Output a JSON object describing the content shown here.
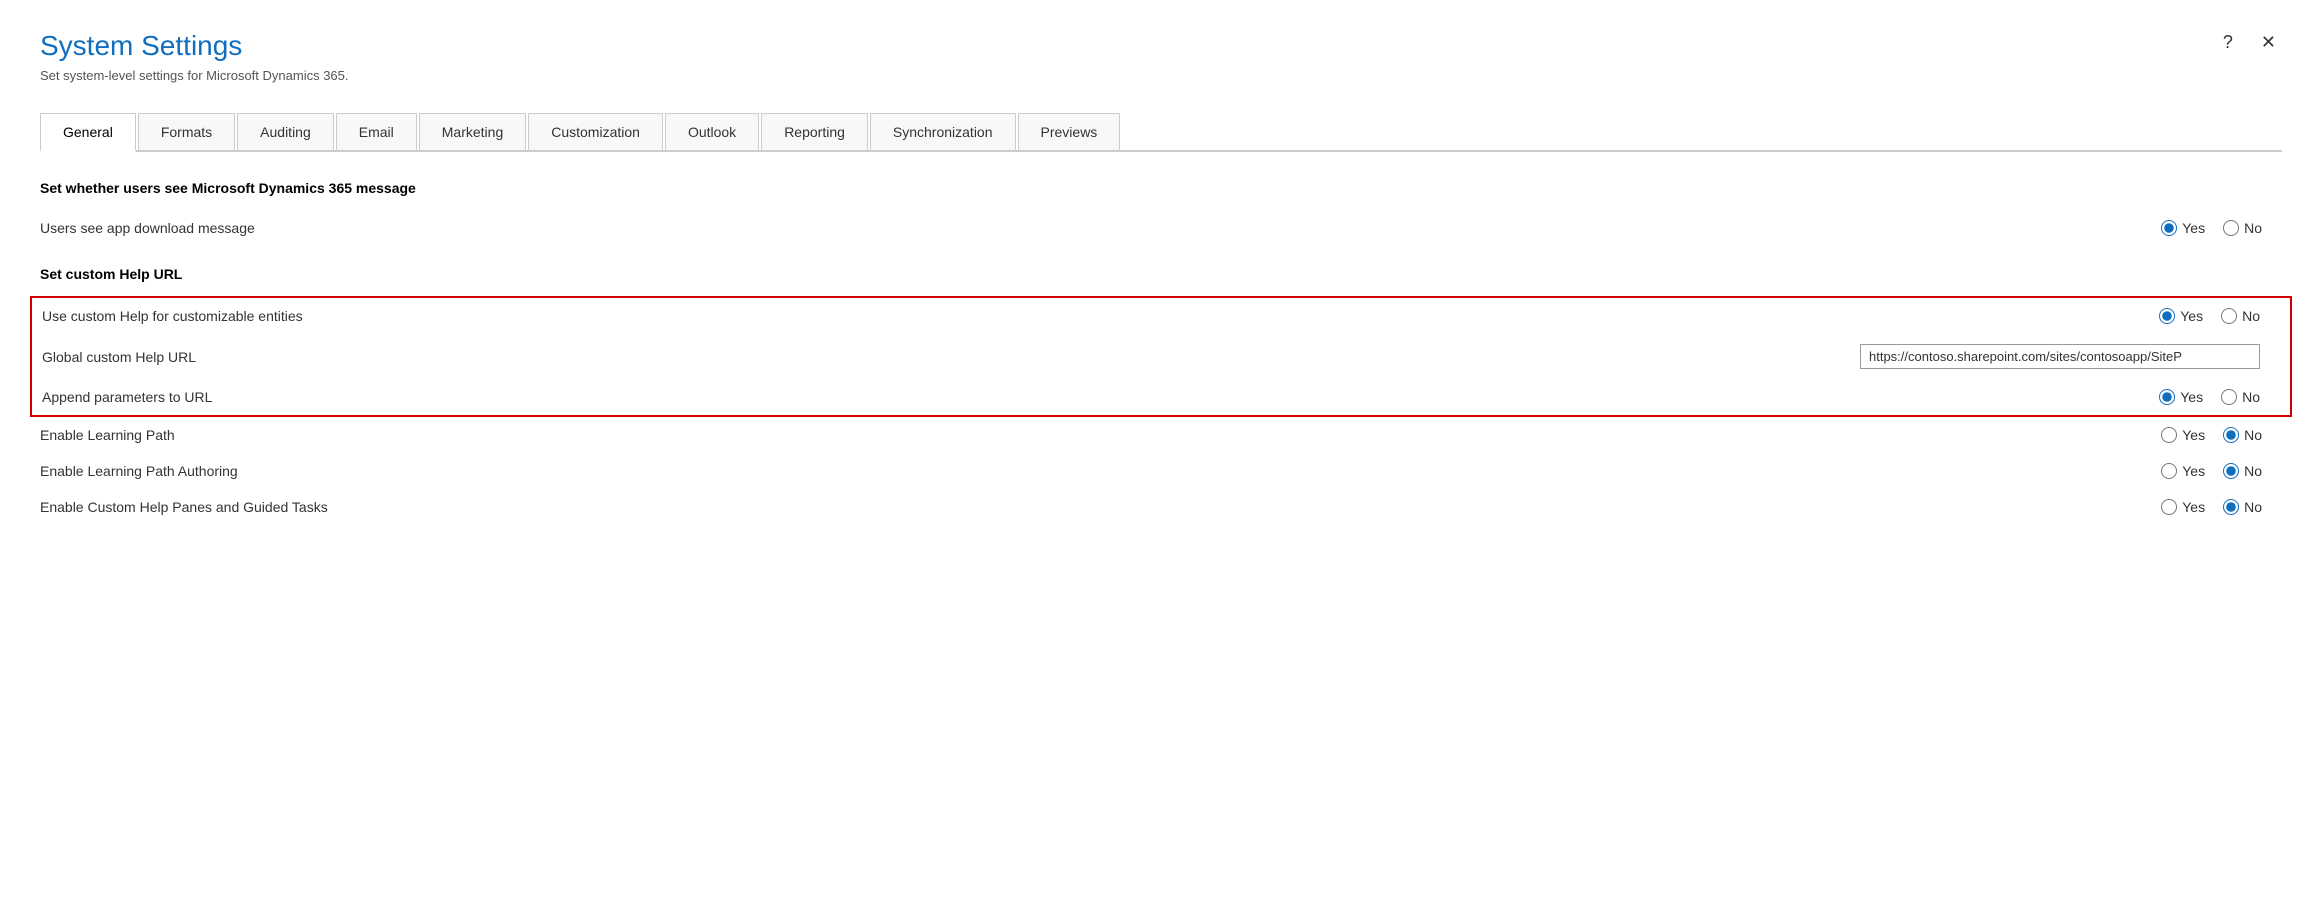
{
  "window": {
    "title": "System Settings",
    "subtitle": "Set system-level settings for Microsoft Dynamics 365.",
    "help_btn": "?",
    "close_btn": "✕"
  },
  "tabs": [
    {
      "id": "general",
      "label": "General",
      "active": true
    },
    {
      "id": "formats",
      "label": "Formats",
      "active": false
    },
    {
      "id": "auditing",
      "label": "Auditing",
      "active": false
    },
    {
      "id": "email",
      "label": "Email",
      "active": false
    },
    {
      "id": "marketing",
      "label": "Marketing",
      "active": false
    },
    {
      "id": "customization",
      "label": "Customization",
      "active": false
    },
    {
      "id": "outlook",
      "label": "Outlook",
      "active": false
    },
    {
      "id": "reporting",
      "label": "Reporting",
      "active": false
    },
    {
      "id": "synchronization",
      "label": "Synchronization",
      "active": false
    },
    {
      "id": "previews",
      "label": "Previews",
      "active": false
    }
  ],
  "sections": {
    "dynamics_message": {
      "heading": "Set whether users see Microsoft Dynamics 365 message",
      "rows": [
        {
          "id": "app_download_message",
          "label": "Users see app download message",
          "type": "radio",
          "value": "yes",
          "options": [
            {
              "value": "yes",
              "label": "Yes"
            },
            {
              "value": "no",
              "label": "No"
            }
          ]
        }
      ]
    },
    "custom_help": {
      "heading": "Set custom Help URL",
      "highlighted": true,
      "rows": [
        {
          "id": "use_custom_help",
          "label": "Use custom Help for customizable entities",
          "type": "radio",
          "value": "yes",
          "options": [
            {
              "value": "yes",
              "label": "Yes"
            },
            {
              "value": "no",
              "label": "No"
            }
          ]
        },
        {
          "id": "global_help_url",
          "label": "Global custom Help URL",
          "type": "text",
          "value": "https://contoso.sharepoint.com/sites/contosoapp/SiteP",
          "placeholder": ""
        },
        {
          "id": "append_params",
          "label": "Append parameters to URL",
          "type": "radio",
          "value": "yes",
          "options": [
            {
              "value": "yes",
              "label": "Yes"
            },
            {
              "value": "no",
              "label": "No"
            }
          ]
        }
      ]
    },
    "learning": {
      "heading": "",
      "rows": [
        {
          "id": "enable_learning_path",
          "label": "Enable Learning Path",
          "type": "radio",
          "value": "no",
          "options": [
            {
              "value": "yes",
              "label": "Yes"
            },
            {
              "value": "no",
              "label": "No"
            }
          ]
        },
        {
          "id": "enable_learning_path_authoring",
          "label": "Enable Learning Path Authoring",
          "type": "radio",
          "value": "no",
          "options": [
            {
              "value": "yes",
              "label": "Yes"
            },
            {
              "value": "no",
              "label": "No"
            }
          ]
        },
        {
          "id": "enable_custom_help_panes",
          "label": "Enable Custom Help Panes and Guided Tasks",
          "type": "radio",
          "value": "no",
          "options": [
            {
              "value": "yes",
              "label": "Yes"
            },
            {
              "value": "no",
              "label": "No"
            }
          ]
        }
      ]
    }
  }
}
